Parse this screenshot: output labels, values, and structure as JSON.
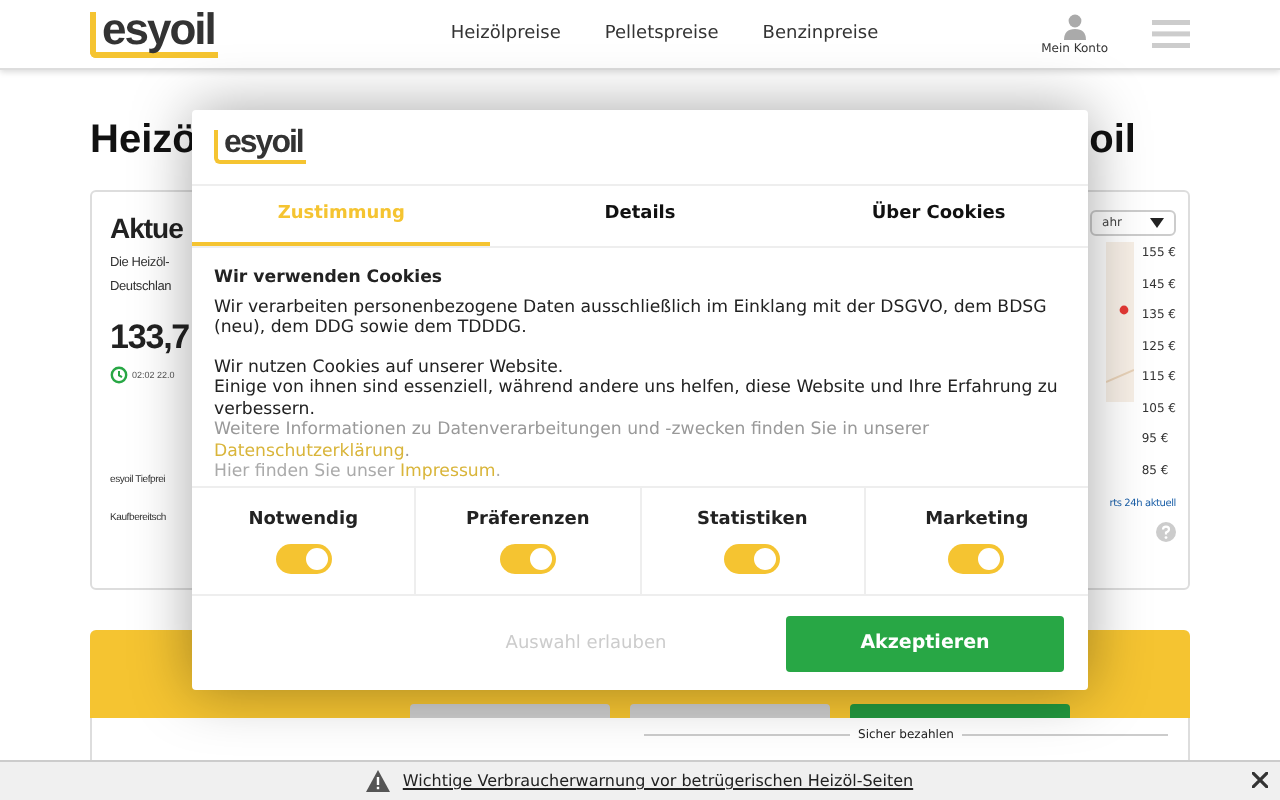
{
  "header": {
    "logo": "esyoil",
    "nav": [
      "Heizölpreise",
      "Pelletspreise",
      "Benzinpreise"
    ],
    "account": "Mein Konto"
  },
  "page": {
    "heading_start": "Heizö",
    "heading_end": "oil",
    "card": {
      "title": "Aktue",
      "lines": [
        "Die Heizöl-",
        "Deutschlan"
      ],
      "price": "133,7",
      "timestamp": "02:02 22.0",
      "rows": [
        "esyoil Tiefprei",
        "Kaufbereitsch"
      ],
      "range_select": "ahr",
      "y_axis_labels": [
        "155 €",
        "145 €",
        "135 €",
        "125 €",
        "115 €",
        "105 €",
        "95 €",
        "85 €"
      ],
      "chart_link": "rts 24h aktuell"
    },
    "payment_label": "Sicher bezahlen"
  },
  "cookie_dialog": {
    "logo": "esyoil",
    "tabs": [
      {
        "label": "Zustimmung",
        "selected": true
      },
      {
        "label": "Details",
        "selected": false
      },
      {
        "label": "Über Cookies",
        "selected": false
      }
    ],
    "title": "Wir verwenden Cookies",
    "paragraphs": [
      {
        "lines": [
          {
            "text": "Wir verarbeiten personenbezogene Daten ausschließlich im Einklang mit der DSGVO, dem BDSG (neu), dem DDG sowie dem TDDDG."
          }
        ]
      },
      {
        "lines": [
          {
            "text": "Wir nutzen Cookies auf unserer Website."
          },
          {
            "text": "Einige von ihnen sind essenziell, während andere uns helfen, diese Website und Ihre Erfahrung zu verbessern."
          },
          {
            "text": "Weitere Informationen zu Datenverarbeitungen und -zwecken finden Sie in unserer ",
            "link": "Datenschutzerklärung",
            "after": "."
          },
          {
            "text": "Hier finden Sie unser ",
            "link": "Impressum",
            "after": "."
          }
        ]
      }
    ],
    "categories": [
      {
        "label": "Notwendig",
        "on": true
      },
      {
        "label": "Präferenzen",
        "on": true
      },
      {
        "label": "Statistiken",
        "on": true
      },
      {
        "label": "Marketing",
        "on": true
      }
    ],
    "allow_button": "Auswahl erlauben",
    "accept_button": "Akzeptieren"
  },
  "warning_bar": {
    "text": "Wichtige Verbraucherwarnung vor betrügerischen Heizöl-Seiten"
  }
}
